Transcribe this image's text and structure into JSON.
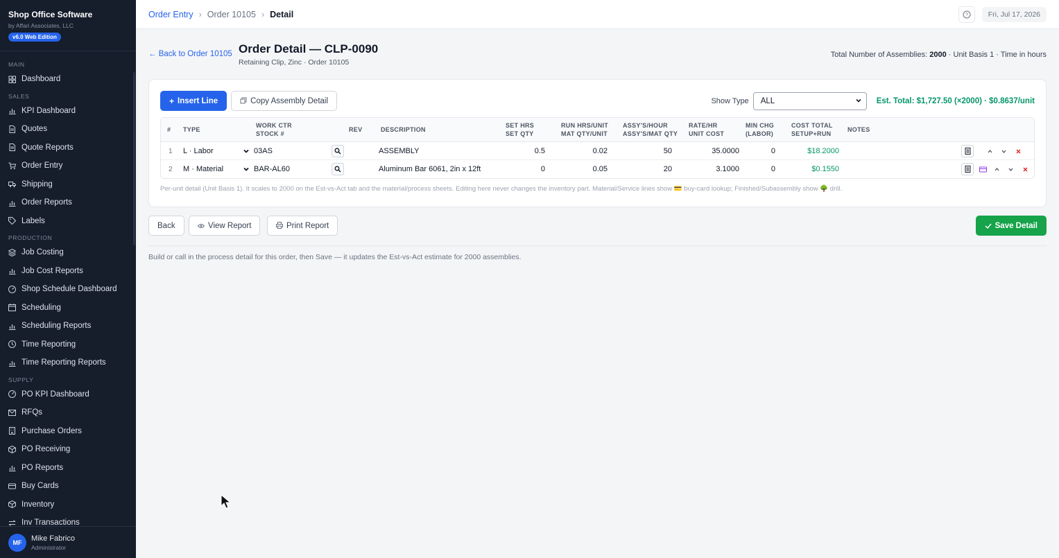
{
  "brand": {
    "title": "Shop Office Software",
    "sub": "by Affari Associates, LLC",
    "badge": "v6.0 Web Edition"
  },
  "nav": {
    "main_label": "MAIN",
    "main": [
      {
        "label": "Dashboard",
        "icon": "grid-icon"
      }
    ],
    "sales_label": "SALES",
    "sales": [
      {
        "label": "KPI Dashboard",
        "icon": "chart-icon"
      },
      {
        "label": "Quotes",
        "icon": "doc-icon"
      },
      {
        "label": "Quote Reports",
        "icon": "doc-icon"
      },
      {
        "label": "Order Entry",
        "icon": "cart-icon"
      },
      {
        "label": "Shipping",
        "icon": "truck-icon"
      },
      {
        "label": "Order Reports",
        "icon": "chart-icon"
      },
      {
        "label": "Labels",
        "icon": "tag-icon"
      }
    ],
    "production_label": "PRODUCTION",
    "production": [
      {
        "label": "Job Costing",
        "icon": "layers-icon"
      },
      {
        "label": "Job Cost Reports",
        "icon": "chart-icon"
      },
      {
        "label": "Shop Schedule Dashboard",
        "icon": "gauge-icon"
      },
      {
        "label": "Scheduling",
        "icon": "calendar-icon"
      },
      {
        "label": "Scheduling Reports",
        "icon": "chart-icon"
      },
      {
        "label": "Time Reporting",
        "icon": "clock-icon"
      },
      {
        "label": "Time Reporting Reports",
        "icon": "chart-icon"
      }
    ],
    "supply_label": "SUPPLY",
    "supply": [
      {
        "label": "PO KPI Dashboard",
        "icon": "gauge-icon"
      },
      {
        "label": "RFQs",
        "icon": "mail-icon"
      },
      {
        "label": "Purchase Orders",
        "icon": "building-icon"
      },
      {
        "label": "PO Receiving",
        "icon": "box-icon"
      },
      {
        "label": "PO Reports",
        "icon": "chart-icon"
      },
      {
        "label": "Buy Cards",
        "icon": "card-icon"
      },
      {
        "label": "Inventory",
        "icon": "box-icon"
      },
      {
        "label": "Inv Transactions",
        "icon": "swap-icon"
      }
    ]
  },
  "user": {
    "initials": "MF",
    "name": "Mike Fabrico",
    "role": "Administrator"
  },
  "breadcrumb": {
    "c1": "Order Entry",
    "c2": "Order 10105",
    "c3": "Detail"
  },
  "topbar": {
    "date": "Fri, Jul 17, 2026"
  },
  "header": {
    "back": "← Back to Order 10105",
    "title": "Order Detail — CLP-0090",
    "subtitle": "Retaining Clip, Zinc · Order 10105",
    "summary_prefix": "Total Number of Assemblies:",
    "summary_count": "2000",
    "summary_rest": "· Unit Basis 1 · Time in hours"
  },
  "toolbar": {
    "insert": "Insert Line",
    "copy": "Copy Assembly Detail",
    "show_type_label": "Show Type",
    "show_type_value": "ALL",
    "est_total": "Est. Total: $1,727.50 (×2000) · $0.8637/unit"
  },
  "columns": {
    "num": "#",
    "type": "TYPE",
    "wc1": "WORK CTR",
    "wc2": "STOCK #",
    "rev": "REV",
    "desc": "DESCRIPTION",
    "set1": "SET HRS",
    "set2": "SET QTY",
    "run1": "RUN HRS/UNIT",
    "run2": "MAT QTY/UNIT",
    "assy1": "ASSY'S/HOUR",
    "assy2": "ASSY'S/MAT QTY",
    "rate1": "RATE/HR",
    "rate2": "UNIT COST",
    "min1": "MIN CHG",
    "min2": "(LABOR)",
    "cost1": "COST TOTAL",
    "cost2": "SETUP+RUN",
    "notes": "NOTES"
  },
  "rows": [
    {
      "num": "1",
      "type": "L · Labor",
      "stock": "03AS",
      "rev": "",
      "desc": "ASSEMBLY",
      "set": "0.5",
      "run": "0.02",
      "assy": "50",
      "rate": "35.0000",
      "min": "0",
      "cost": "$18.2000"
    },
    {
      "num": "2",
      "type": "M · Material",
      "stock": "BAR-AL60",
      "rev": "",
      "desc": "Aluminum Bar 6061, 2in x 12ft",
      "set": "0",
      "run": "0.05",
      "assy": "20",
      "rate": "3.1000",
      "min": "0",
      "cost": "$0.1550"
    }
  ],
  "card_note": "Per-unit detail (Unit Basis 1). It scales to 2000 on the Est-vs-Act tab and the material/process sheets. Editing here never changes the inventory part. Material/Service lines show 💳 buy-card lookup; Finished/Subassembly show 🌳 drill.",
  "actions": {
    "back": "Back",
    "view": "View Report",
    "print": "Print Report",
    "save": "Save Detail"
  },
  "helper": "Build or call in the process detail for this order, then Save — it updates the Est-vs-Act estimate for 2000 assemblies.",
  "colors": {
    "accent": "#2563eb",
    "success": "#16a34a",
    "money": "#059669",
    "sidebar": "#161d2b"
  }
}
